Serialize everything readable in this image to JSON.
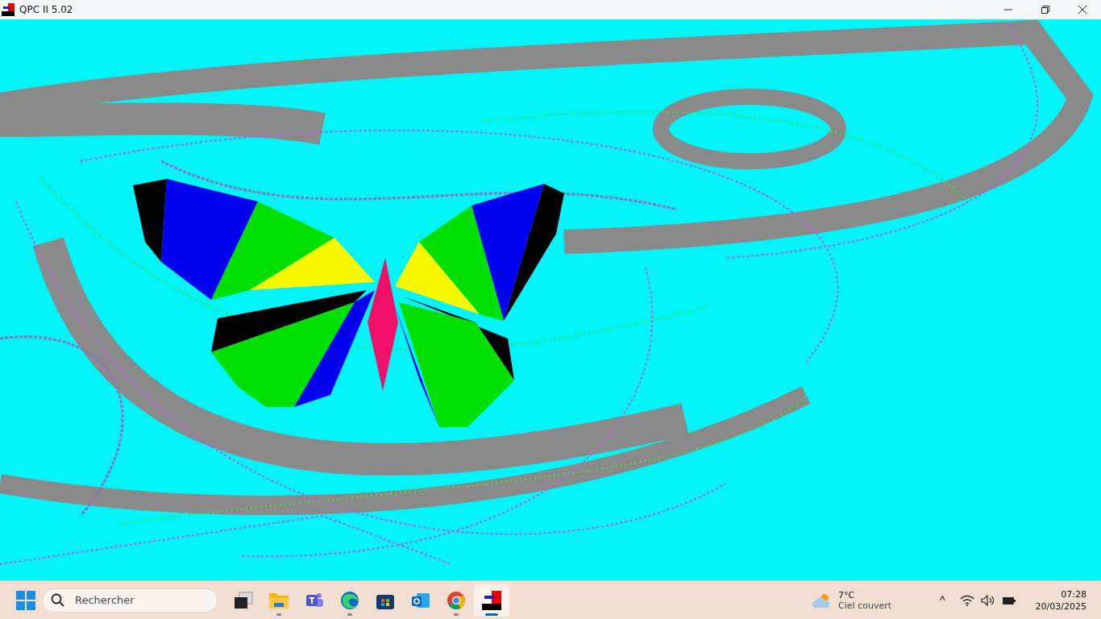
{
  "window": {
    "title": "QPC II 5.02"
  },
  "taskbar": {
    "search": {
      "placeholder": "Rechercher"
    },
    "apps": [
      {
        "kind": "task-view",
        "running": false,
        "selected": false
      },
      {
        "kind": "folder",
        "running": true,
        "selected": false
      },
      {
        "kind": "teams",
        "running": false,
        "selected": false
      },
      {
        "kind": "edge",
        "running": true,
        "selected": false
      },
      {
        "kind": "store",
        "running": false,
        "selected": false
      },
      {
        "kind": "outlook",
        "running": false,
        "selected": false
      },
      {
        "kind": "chrome",
        "running": true,
        "selected": false
      },
      {
        "kind": "qpc",
        "running": true,
        "selected": true
      }
    ],
    "weather": {
      "temperature": "7°C",
      "condition": "Ciel couvert"
    },
    "tray": {
      "overflow": "^"
    },
    "clock": {
      "time": "07:28",
      "date": "20/03/2025"
    }
  }
}
